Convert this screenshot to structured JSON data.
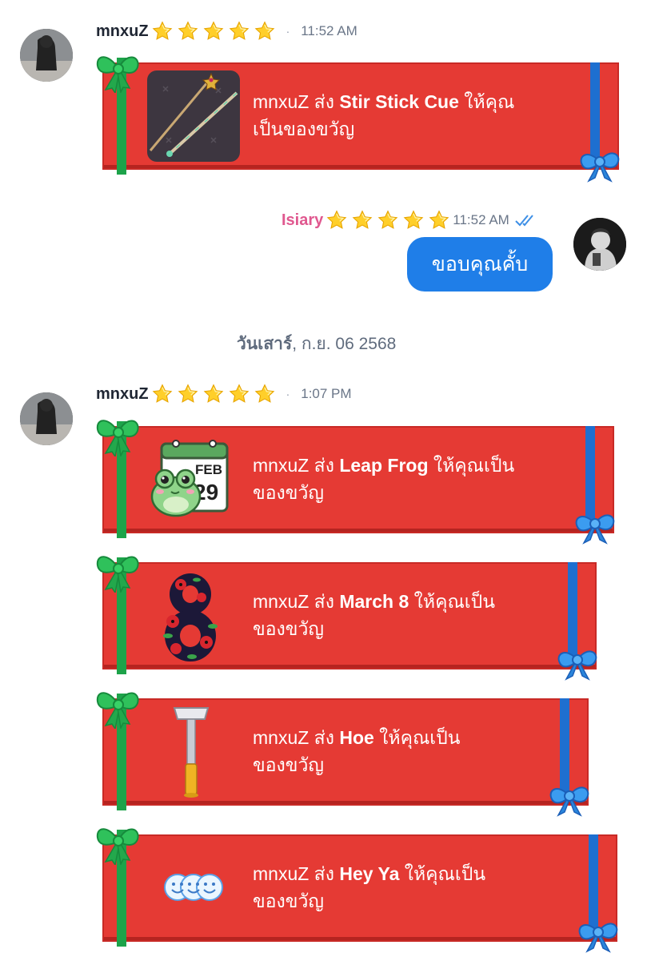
{
  "messages": [
    {
      "sender": "mnxuZ",
      "time": "11:52 AM",
      "gifts": [
        {
          "prefix": "mnxuZ ส่ง ",
          "item": "Stir Stick Cue",
          "suffix": " ให้คุณ",
          "line2": "เป็นของขวัญ",
          "icon": "cue-stick-icon"
        }
      ]
    },
    {
      "sender": "Isiary",
      "time": "11:52 AM",
      "text": "ขอบคุณคั้บ",
      "status_icon": "double-check-icon"
    },
    {
      "date_bold": "วันเสาร์",
      "date_rest": ", ก.ย. 06 2568"
    },
    {
      "sender": "mnxuZ",
      "time": "1:07 PM",
      "gifts": [
        {
          "prefix": "mnxuZ ส่ง ",
          "item": "Leap Frog",
          "suffix": " ให้คุณเป็น",
          "line2": "ของขวัญ",
          "icon": "frog-calendar-icon",
          "calendar_month": "FEB",
          "calendar_day": "29"
        },
        {
          "prefix": "mnxuZ ส่ง ",
          "item": "March 8",
          "suffix": " ให้คุณเป็น",
          "line2": "ของขวัญ",
          "icon": "flower-eight-icon"
        },
        {
          "prefix": "mnxuZ ส่ง ",
          "item": "Hoe",
          "suffix": " ให้คุณเป็น",
          "line2": "ของขวัญ",
          "icon": "hoe-icon"
        },
        {
          "prefix": "mnxuZ ส่ง ",
          "item": "Hey Ya",
          "suffix": " ให้คุณเป็น",
          "line2": "ของขวัญ",
          "icon": "smiley-faces-icon"
        }
      ]
    }
  ],
  "colors": {
    "gift_bg": "#e53a34",
    "bubble": "#1f7ee8",
    "own_name": "#e0588f",
    "ribbon_green": "#1da34a",
    "ribbon_blue": "#1e6fd0"
  }
}
